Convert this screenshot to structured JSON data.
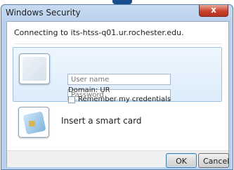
{
  "window": {
    "title": "Windows Security",
    "close_glyph": "x"
  },
  "message": {
    "connecting": "Connecting to its-htss-q01.ur.rochester.edu."
  },
  "credentials": {
    "username_placeholder": "User name",
    "password_placeholder": "Password",
    "domain_text": "Domain: UR",
    "remember_label": "Remember my credentials",
    "remember_checked": false,
    "user_tile_icon": "user-tile-icon"
  },
  "smartcard": {
    "label": "Insert a smart card",
    "icon": "smart-card-icon"
  },
  "buttons": {
    "ok_label": "OK",
    "cancel_label": "Cancel"
  },
  "colors": {
    "title_bar": "#b9d1ee",
    "close_button": "#c8432e",
    "selected_tile_bg": "#dcecfb",
    "selected_tile_border": "#9cc3e6"
  }
}
